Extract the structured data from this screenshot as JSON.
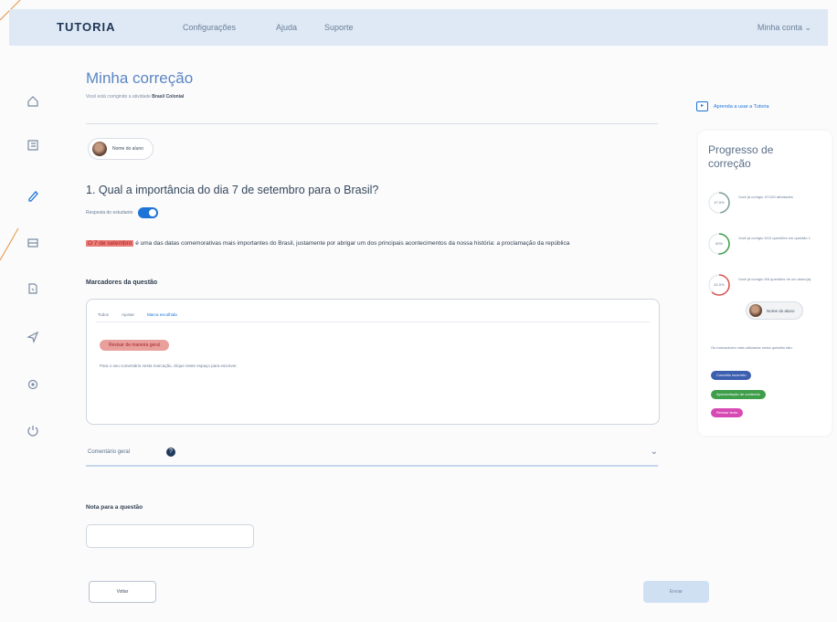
{
  "header": {
    "logo": "TUTORIA",
    "nav": [
      {
        "label": "Configurações"
      },
      {
        "label": "Ajuda"
      },
      {
        "label": "Suporte"
      }
    ],
    "user_menu": "Minha conta ⌄"
  },
  "sidebar": {
    "items": [
      {
        "name": "home-icon",
        "glyph": "⌂"
      },
      {
        "name": "list-icon",
        "glyph": "☰"
      },
      {
        "name": "pen-icon",
        "glyph": "✎",
        "active": true
      },
      {
        "name": "grid-icon",
        "glyph": "▦"
      },
      {
        "name": "document-icon",
        "glyph": "▤"
      },
      {
        "name": "send-icon",
        "glyph": "➤"
      },
      {
        "name": "settings-icon",
        "glyph": "⚙"
      },
      {
        "name": "power-icon",
        "glyph": "⏻"
      }
    ]
  },
  "main": {
    "title": "Minha correção",
    "subtitle_prefix": "Você está corrigindo a atividade",
    "subtitle_bold": "Brasil Colonial",
    "student_chip": "Nome do aluno",
    "question": "1. Qual a importância do dia 7 de setembro para o Brasil?",
    "toggle_label": "Resposta do estudante",
    "answer_highlight": "O 7 de setembro",
    "answer_rest": " é uma das datas comemorativas mais importantes do Brasil, justamente por abrigar um dos principais acontecimentos da nossa história: a proclamação da república",
    "markers_title": "Marcadores da questão",
    "marker_tabs": [
      "Todos",
      "Ajustar",
      "Marca escolhida"
    ],
    "marker_tag": "Revisar de maneira geral",
    "marker_text": "Para o seu comentário nesta marcação, clique neste espaço para escrever.",
    "comment_label": "Comentário geral",
    "grade_label": "Nota para a questão",
    "grade_value": "",
    "back_button": "Voltar",
    "send_button": "Enviar"
  },
  "right_panel": {
    "learn_link": "Aprenda a usar a Tutoria",
    "progress_title": "Progresso de correção",
    "stats": [
      {
        "percent": "47,5%",
        "text": "Você já corrigiu 47/100 atividades",
        "color": "#7c9d9a"
      },
      {
        "percent": "50%",
        "text": "Você já corrigiu 5/10 questões em questão 1",
        "color": "#3e9e4a"
      },
      {
        "percent": "62,5%",
        "text": "Você já corrigiu 5/8 questões de um aluno(a)",
        "color": "#d9534f"
      }
    ],
    "stat_chip": "Nome do aluno",
    "legend_text": "Os marcadores mais utilizados nesta questão são:",
    "pills": [
      {
        "label": "Conceito incorreto",
        "color": "#3d5fb0"
      },
      {
        "label": "Apresentação de conteúdo",
        "color": "#3e9e4a"
      },
      {
        "label": "Revisar texto",
        "color": "#d74ab4"
      }
    ]
  }
}
